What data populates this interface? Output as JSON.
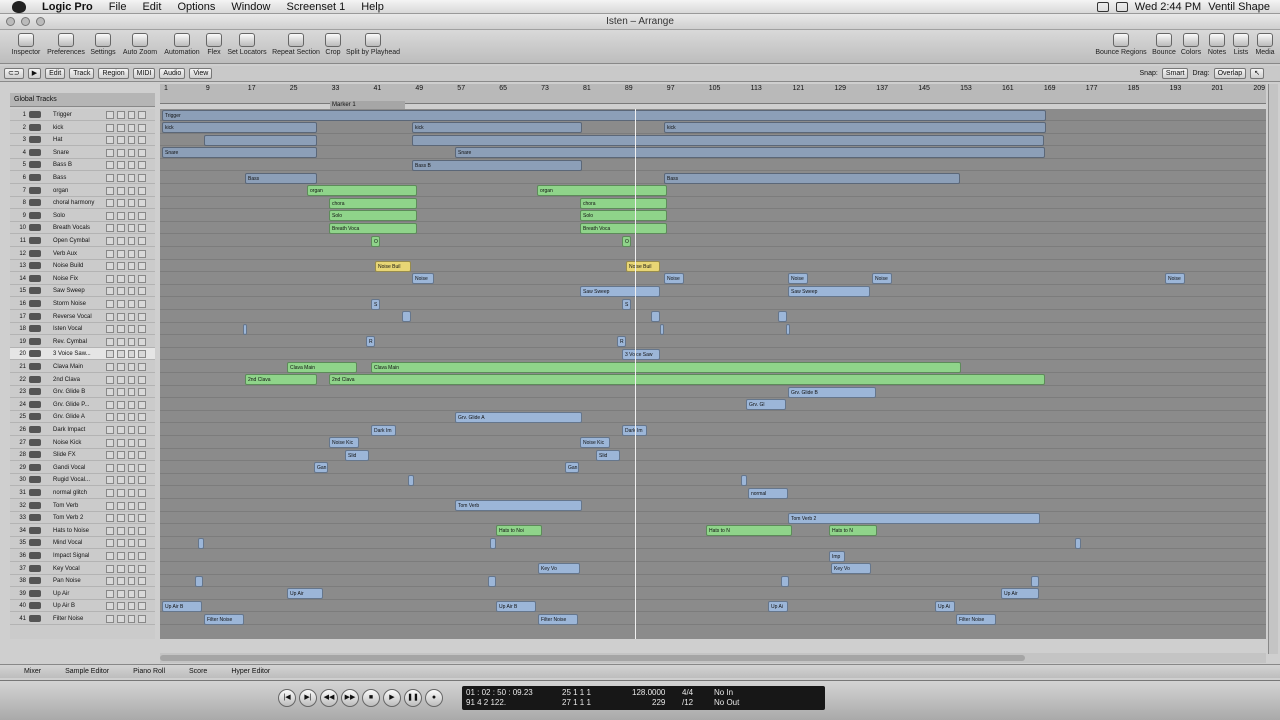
{
  "menubar": {
    "app": "Logic Pro",
    "items": [
      "File",
      "Edit",
      "Options",
      "Window",
      "Screenset 1",
      "Help"
    ],
    "clock": "Wed 2:44 PM",
    "user": "Ventil Shape"
  },
  "window": {
    "title": "Isten – Arrange"
  },
  "toolbar": {
    "left": [
      "Inspector",
      "Preferences",
      "Settings",
      "Auto Zoom",
      "Automation",
      "Flex",
      "Set Locators",
      "Repeat Section",
      "Crop",
      "Split by Playhead"
    ],
    "right": [
      "Bounce Regions",
      "Bounce",
      "Colors",
      "Notes",
      "Lists",
      "Media"
    ]
  },
  "local": {
    "menus": [
      "Edit",
      "Track",
      "Region",
      "MIDI",
      "Audio",
      "View"
    ],
    "snap_label": "Snap:",
    "snap": "Smart",
    "drag_label": "Drag:",
    "drag": "Overlap"
  },
  "global_tracks": "Global Tracks",
  "marker": "Marker 1",
  "ruler": [
    "1",
    "9",
    "17",
    "25",
    "33",
    "41",
    "49",
    "57",
    "65",
    "73",
    "81",
    "89",
    "97",
    "105",
    "113",
    "121",
    "129",
    "137",
    "145",
    "153",
    "161",
    "169",
    "177",
    "185",
    "193",
    "201",
    "209"
  ],
  "tracks": [
    {
      "n": "1",
      "name": "Trigger"
    },
    {
      "n": "2",
      "name": "kick"
    },
    {
      "n": "3",
      "name": "Hat"
    },
    {
      "n": "4",
      "name": "Snare"
    },
    {
      "n": "5",
      "name": "Bass B"
    },
    {
      "n": "6",
      "name": "Bass"
    },
    {
      "n": "7",
      "name": "organ"
    },
    {
      "n": "8",
      "name": "choral harmony"
    },
    {
      "n": "9",
      "name": "Solo"
    },
    {
      "n": "10",
      "name": "Breath Vocals"
    },
    {
      "n": "11",
      "name": "Open Cymbal"
    },
    {
      "n": "12",
      "name": "Verb Aux"
    },
    {
      "n": "13",
      "name": "Noise Build"
    },
    {
      "n": "14",
      "name": "Noise Fix"
    },
    {
      "n": "15",
      "name": "Saw Sweep"
    },
    {
      "n": "16",
      "name": "Storm Noise"
    },
    {
      "n": "17",
      "name": "Reverse Vocal"
    },
    {
      "n": "18",
      "name": "Isten Vocal"
    },
    {
      "n": "19",
      "name": "Rev. Cymbal"
    },
    {
      "n": "20",
      "name": "3 Voice Saw..."
    },
    {
      "n": "21",
      "name": "Clava Main"
    },
    {
      "n": "22",
      "name": "2nd Clava"
    },
    {
      "n": "23",
      "name": "Grv. Glide B"
    },
    {
      "n": "24",
      "name": "Grv. Glide P..."
    },
    {
      "n": "25",
      "name": "Grv. Glide A"
    },
    {
      "n": "26",
      "name": "Dark Impact"
    },
    {
      "n": "27",
      "name": "Noise Kick"
    },
    {
      "n": "28",
      "name": "Slide FX"
    },
    {
      "n": "29",
      "name": "Gandi Vocal"
    },
    {
      "n": "30",
      "name": "Rugid Vocal..."
    },
    {
      "n": "31",
      "name": "normal glitch"
    },
    {
      "n": "32",
      "name": "Tom Verb"
    },
    {
      "n": "33",
      "name": "Tom Verb 2"
    },
    {
      "n": "34",
      "name": "Hats to Noise"
    },
    {
      "n": "35",
      "name": "Mind Vocal"
    },
    {
      "n": "36",
      "name": "Impact Signal"
    },
    {
      "n": "37",
      "name": "Key Vocal"
    },
    {
      "n": "38",
      "name": "Pan Noise"
    },
    {
      "n": "39",
      "name": "Up Air"
    },
    {
      "n": "40",
      "name": "Up Air B"
    },
    {
      "n": "41",
      "name": "Filter Noise"
    }
  ],
  "regions": [
    {
      "t": 0,
      "s": 162,
      "w": 884,
      "l": "Trigger",
      "c": "#8c9fb8"
    },
    {
      "t": 1,
      "s": 162,
      "w": 155,
      "l": "kick",
      "c": "#8c9fb8"
    },
    {
      "t": 1,
      "s": 412,
      "w": 170,
      "l": "kick",
      "c": "#8c9fb8"
    },
    {
      "t": 1,
      "s": 664,
      "w": 382,
      "l": "kick",
      "c": "#8c9fb8"
    },
    {
      "t": 2,
      "s": 204,
      "w": 113,
      "l": "",
      "c": "#8c9fb8"
    },
    {
      "t": 2,
      "s": 412,
      "w": 632,
      "l": "",
      "c": "#8c9fb8"
    },
    {
      "t": 3,
      "s": 162,
      "w": 155,
      "l": "Snare",
      "c": "#8c9fb8"
    },
    {
      "t": 3,
      "s": 455,
      "w": 590,
      "l": "Snare",
      "c": "#8c9fb8"
    },
    {
      "t": 4,
      "s": 412,
      "w": 170,
      "l": "Bass B",
      "c": "#8c9fb8"
    },
    {
      "t": 5,
      "s": 245,
      "w": 72,
      "l": "Bass",
      "c": "#8c9fb8"
    },
    {
      "t": 5,
      "s": 664,
      "w": 296,
      "l": "Bass",
      "c": "#8c9fb8"
    },
    {
      "t": 6,
      "s": 307,
      "w": 110,
      "l": "organ",
      "c": "#8fd48a"
    },
    {
      "t": 6,
      "s": 537,
      "w": 130,
      "l": "organ",
      "c": "#8fd48a"
    },
    {
      "t": 7,
      "s": 329,
      "w": 88,
      "l": "chora",
      "c": "#8fd48a"
    },
    {
      "t": 7,
      "s": 580,
      "w": 87,
      "l": "chora",
      "c": "#8fd48a"
    },
    {
      "t": 8,
      "s": 329,
      "w": 88,
      "l": "Solo",
      "c": "#8fd48a"
    },
    {
      "t": 8,
      "s": 580,
      "w": 87,
      "l": "Solo",
      "c": "#8fd48a"
    },
    {
      "t": 9,
      "s": 329,
      "w": 88,
      "l": "Breath Voca",
      "c": "#8fd48a"
    },
    {
      "t": 9,
      "s": 580,
      "w": 87,
      "l": "Breath Voca",
      "c": "#8fd48a"
    },
    {
      "t": 10,
      "s": 371,
      "w": 9,
      "l": "O",
      "c": "#8fd48a"
    },
    {
      "t": 10,
      "s": 622,
      "w": 9,
      "l": "O",
      "c": "#8fd48a"
    },
    {
      "t": 12,
      "s": 375,
      "w": 36,
      "l": "Noise Buil",
      "c": "#e8d675"
    },
    {
      "t": 12,
      "s": 626,
      "w": 34,
      "l": "Noise Buil",
      "c": "#e8d675"
    },
    {
      "t": 13,
      "s": 412,
      "w": 22,
      "l": "Noise",
      "c": "#9cb6d8"
    },
    {
      "t": 13,
      "s": 664,
      "w": 20,
      "l": "Noise",
      "c": "#9cb6d8"
    },
    {
      "t": 13,
      "s": 788,
      "w": 20,
      "l": "Noise",
      "c": "#9cb6d8"
    },
    {
      "t": 13,
      "s": 872,
      "w": 20,
      "l": "Noise",
      "c": "#9cb6d8"
    },
    {
      "t": 13,
      "s": 1165,
      "w": 20,
      "l": "Noise",
      "c": "#9cb6d8"
    },
    {
      "t": 14,
      "s": 580,
      "w": 80,
      "l": "Saw Sweep",
      "c": "#9cb6d8"
    },
    {
      "t": 14,
      "s": 788,
      "w": 82,
      "l": "Saw Sweep",
      "c": "#9cb6d8"
    },
    {
      "t": 15,
      "s": 371,
      "w": 9,
      "l": "S",
      "c": "#9cb6d8"
    },
    {
      "t": 15,
      "s": 622,
      "w": 9,
      "l": "S",
      "c": "#9cb6d8"
    },
    {
      "t": 16,
      "s": 402,
      "w": 9,
      "l": "",
      "c": "#9cb6d8"
    },
    {
      "t": 16,
      "s": 651,
      "w": 9,
      "l": "",
      "c": "#9cb6d8"
    },
    {
      "t": 16,
      "s": 778,
      "w": 9,
      "l": "",
      "c": "#9cb6d8"
    },
    {
      "t": 17,
      "s": 243,
      "w": 4,
      "l": "",
      "c": "#9cb6d8"
    },
    {
      "t": 17,
      "s": 660,
      "w": 4,
      "l": "",
      "c": "#9cb6d8"
    },
    {
      "t": 17,
      "s": 786,
      "w": 4,
      "l": "",
      "c": "#9cb6d8"
    },
    {
      "t": 18,
      "s": 366,
      "w": 9,
      "l": "R",
      "c": "#9cb6d8"
    },
    {
      "t": 18,
      "s": 617,
      "w": 9,
      "l": "R",
      "c": "#9cb6d8"
    },
    {
      "t": 19,
      "s": 622,
      "w": 38,
      "l": "3 Voice Saw",
      "c": "#9cb6d8"
    },
    {
      "t": 20,
      "s": 287,
      "w": 70,
      "l": "Clava Main",
      "c": "#8fd48a"
    },
    {
      "t": 20,
      "s": 371,
      "w": 590,
      "l": "Clava Main",
      "c": "#8fd48a"
    },
    {
      "t": 21,
      "s": 245,
      "w": 72,
      "l": "2nd Clava",
      "c": "#8fd48a"
    },
    {
      "t": 21,
      "s": 329,
      "w": 716,
      "l": "2nd Clava",
      "c": "#8fd48a"
    },
    {
      "t": 22,
      "s": 788,
      "w": 88,
      "l": "Grv. Glide B",
      "c": "#9cb6d8"
    },
    {
      "t": 23,
      "s": 746,
      "w": 40,
      "l": "Grv. Gl",
      "c": "#9cb6d8"
    },
    {
      "t": 24,
      "s": 455,
      "w": 127,
      "l": "Grv. Glide A",
      "c": "#9cb6d8"
    },
    {
      "t": 25,
      "s": 371,
      "w": 25,
      "l": "Dark Im",
      "c": "#9cb6d8"
    },
    {
      "t": 25,
      "s": 622,
      "w": 25,
      "l": "Dark Im",
      "c": "#9cb6d8"
    },
    {
      "t": 26,
      "s": 329,
      "w": 30,
      "l": "Noise Kic",
      "c": "#9cb6d8"
    },
    {
      "t": 26,
      "s": 580,
      "w": 30,
      "l": "Noise Kic",
      "c": "#9cb6d8"
    },
    {
      "t": 27,
      "s": 345,
      "w": 24,
      "l": "Slid",
      "c": "#9cb6d8"
    },
    {
      "t": 27,
      "s": 596,
      "w": 24,
      "l": "Slid",
      "c": "#9cb6d8"
    },
    {
      "t": 28,
      "s": 314,
      "w": 14,
      "l": "Gan",
      "c": "#9cb6d8"
    },
    {
      "t": 28,
      "s": 565,
      "w": 14,
      "l": "Gan",
      "c": "#9cb6d8"
    },
    {
      "t": 29,
      "s": 408,
      "w": 6,
      "l": "",
      "c": "#9cb6d8"
    },
    {
      "t": 29,
      "s": 741,
      "w": 6,
      "l": "",
      "c": "#9cb6d8"
    },
    {
      "t": 30,
      "s": 748,
      "w": 40,
      "l": "normal",
      "c": "#9cb6d8"
    },
    {
      "t": 31,
      "s": 455,
      "w": 127,
      "l": "Tom Verb",
      "c": "#9cb6d8"
    },
    {
      "t": 32,
      "s": 788,
      "w": 252,
      "l": "Tom Verb 2",
      "c": "#9cb6d8"
    },
    {
      "t": 33,
      "s": 496,
      "w": 46,
      "l": "Hats to Noi",
      "c": "#8fd48a"
    },
    {
      "t": 33,
      "s": 706,
      "w": 86,
      "l": "Hats to N",
      "c": "#8fd48a"
    },
    {
      "t": 33,
      "s": 829,
      "w": 48,
      "l": "Hats to N",
      "c": "#8fd48a"
    },
    {
      "t": 34,
      "s": 198,
      "w": 6,
      "l": "",
      "c": "#9cb6d8"
    },
    {
      "t": 34,
      "s": 490,
      "w": 6,
      "l": "",
      "c": "#9cb6d8"
    },
    {
      "t": 34,
      "s": 1075,
      "w": 6,
      "l": "",
      "c": "#9cb6d8"
    },
    {
      "t": 35,
      "s": 829,
      "w": 16,
      "l": "Imp",
      "c": "#9cb6d8"
    },
    {
      "t": 36,
      "s": 538,
      "w": 42,
      "l": "Key Vo",
      "c": "#9cb6d8"
    },
    {
      "t": 36,
      "s": 831,
      "w": 40,
      "l": "Key Vo",
      "c": "#9cb6d8"
    },
    {
      "t": 37,
      "s": 195,
      "w": 8,
      "l": "",
      "c": "#9cb6d8"
    },
    {
      "t": 37,
      "s": 488,
      "w": 8,
      "l": "",
      "c": "#9cb6d8"
    },
    {
      "t": 37,
      "s": 781,
      "w": 8,
      "l": "",
      "c": "#9cb6d8"
    },
    {
      "t": 37,
      "s": 1031,
      "w": 8,
      "l": "",
      "c": "#9cb6d8"
    },
    {
      "t": 38,
      "s": 287,
      "w": 36,
      "l": "Up Air",
      "c": "#9cb6d8"
    },
    {
      "t": 38,
      "s": 1001,
      "w": 38,
      "l": "Up Air",
      "c": "#9cb6d8"
    },
    {
      "t": 39,
      "s": 162,
      "w": 40,
      "l": "Up Air B",
      "c": "#9cb6d8"
    },
    {
      "t": 39,
      "s": 496,
      "w": 40,
      "l": "Up Air B",
      "c": "#9cb6d8"
    },
    {
      "t": 39,
      "s": 768,
      "w": 20,
      "l": "Up Ai",
      "c": "#9cb6d8"
    },
    {
      "t": 39,
      "s": 935,
      "w": 20,
      "l": "Up Ai",
      "c": "#9cb6d8"
    },
    {
      "t": 40,
      "s": 204,
      "w": 40,
      "l": "Filter Noise",
      "c": "#9cb6d8"
    },
    {
      "t": 40,
      "s": 538,
      "w": 40,
      "l": "Filter Noise",
      "c": "#9cb6d8"
    },
    {
      "t": 40,
      "s": 956,
      "w": 40,
      "l": "Filter Noise",
      "c": "#9cb6d8"
    }
  ],
  "editor_tabs": [
    "Mixer",
    "Sample Editor",
    "Piano Roll",
    "Score",
    "Hyper Editor"
  ],
  "lcd": {
    "smpte": "01 : 02 : 50 : 09.23",
    "bars": "91  4  2 122.",
    "loc1": "25  1  1  1",
    "loc2": "27  1  1  1",
    "tempo": "128.0000",
    "div": "229",
    "sig": "4/4",
    "sig2": "/12",
    "in": "No In",
    "out": "No Out"
  }
}
